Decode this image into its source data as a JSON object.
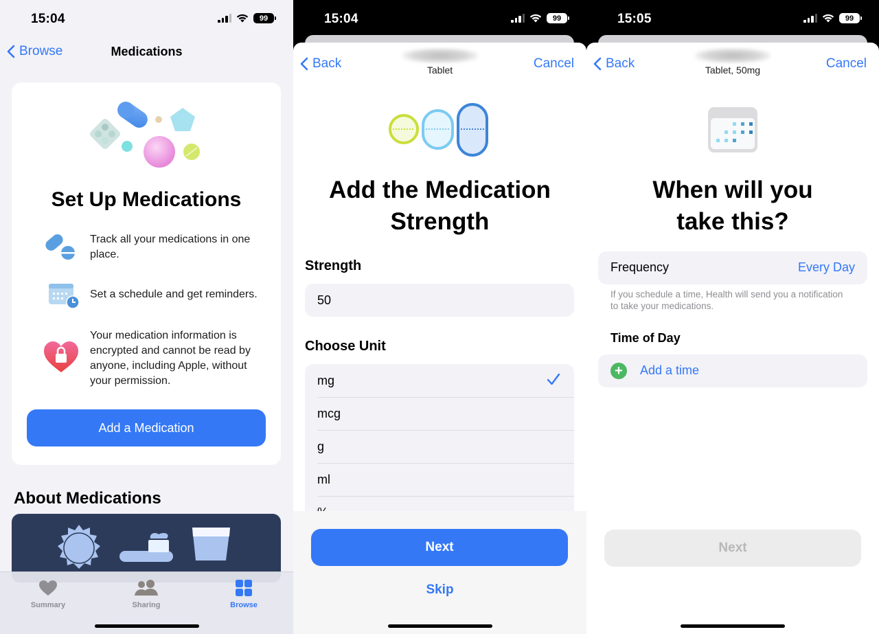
{
  "colors": {
    "accent": "#3478f6",
    "success": "#4cb862",
    "background": "#f2f2f7"
  },
  "panel1": {
    "status": {
      "time": "15:04",
      "battery": "99"
    },
    "nav": {
      "back_label": "Browse",
      "title": "Medications"
    },
    "card": {
      "title": "Set Up Medications",
      "features": [
        {
          "icon": "pills-icon",
          "text": "Track all your medications in one place."
        },
        {
          "icon": "calendar-clock-icon",
          "text": "Set a schedule and get reminders."
        },
        {
          "icon": "heart-lock-icon",
          "text": "Your medication information is encrypted and cannot be read by anyone, including Apple, without your permission."
        }
      ],
      "button_label": "Add a Medication"
    },
    "about_heading": "About Medications",
    "tabs": [
      {
        "label": "Summary",
        "icon": "heart-icon",
        "active": false
      },
      {
        "label": "Sharing",
        "icon": "people-icon",
        "active": false
      },
      {
        "label": "Browse",
        "icon": "grid-icon",
        "active": true
      }
    ]
  },
  "panel2": {
    "status": {
      "time": "15:04",
      "battery": "99"
    },
    "nav": {
      "back_label": "Back",
      "subtitle": "Tablet",
      "cancel_label": "Cancel"
    },
    "title": "Add the Medication Strength",
    "strength_label": "Strength",
    "strength_value": "50",
    "unit_label": "Choose Unit",
    "units": [
      {
        "label": "mg",
        "selected": true
      },
      {
        "label": "mcg",
        "selected": false
      },
      {
        "label": "g",
        "selected": false
      },
      {
        "label": "ml",
        "selected": false
      },
      {
        "label": "%",
        "selected": false
      }
    ],
    "next_label": "Next",
    "skip_label": "Skip"
  },
  "panel3": {
    "status": {
      "time": "15:05",
      "battery": "99"
    },
    "nav": {
      "back_label": "Back",
      "subtitle": "Tablet, 50mg",
      "cancel_label": "Cancel"
    },
    "title": "When will you take this?",
    "frequency_label": "Frequency",
    "frequency_value": "Every Day",
    "footnote": "If you schedule a time, Health will send you a notification to take your medications.",
    "time_of_day_label": "Time of Day",
    "add_time_label": "Add a time",
    "next_label": "Next"
  }
}
